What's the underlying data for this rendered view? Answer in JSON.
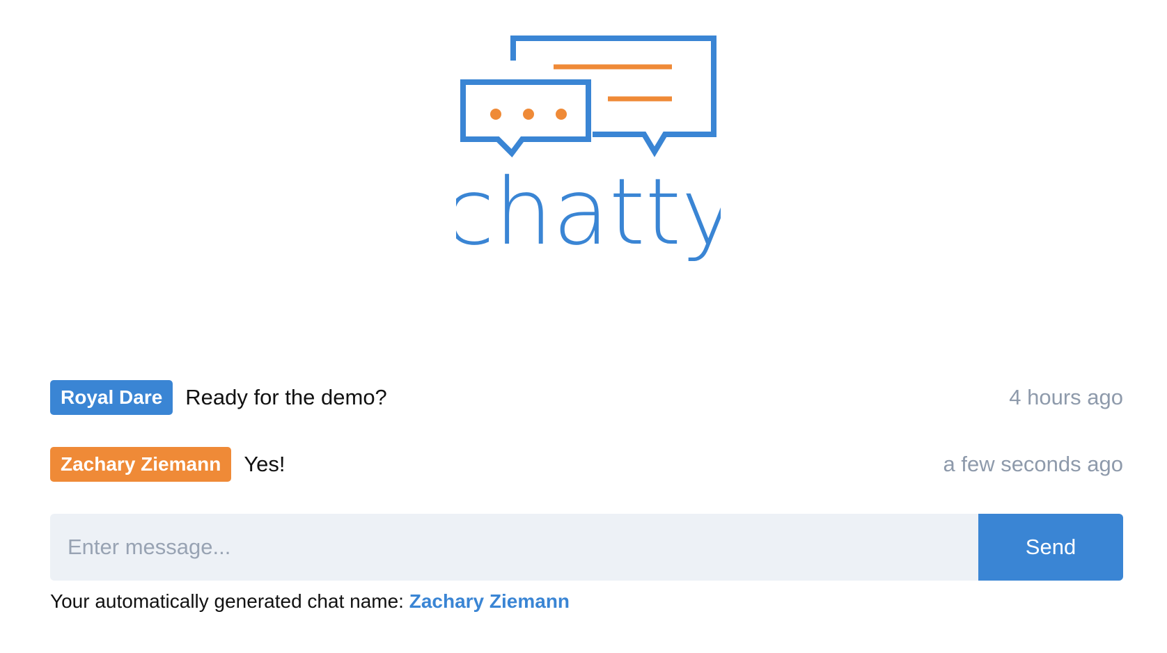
{
  "brand": {
    "name": "chatty",
    "blue": "#3a85d4",
    "orange": "#ef8a37"
  },
  "messages": [
    {
      "author": "Royal Dare",
      "text": "Ready for the demo?",
      "time": "4 hours ago",
      "badge_color": "#3a85d4"
    },
    {
      "author": "Zachary Ziemann",
      "text": "Yes!",
      "time": "a few seconds ago",
      "badge_color": "#ef8a37"
    }
  ],
  "composer": {
    "placeholder": "Enter message...",
    "value": "",
    "send_label": "Send"
  },
  "chat_name": {
    "prefix": "Your automatically generated chat name:",
    "value": "Zachary Ziemann"
  }
}
